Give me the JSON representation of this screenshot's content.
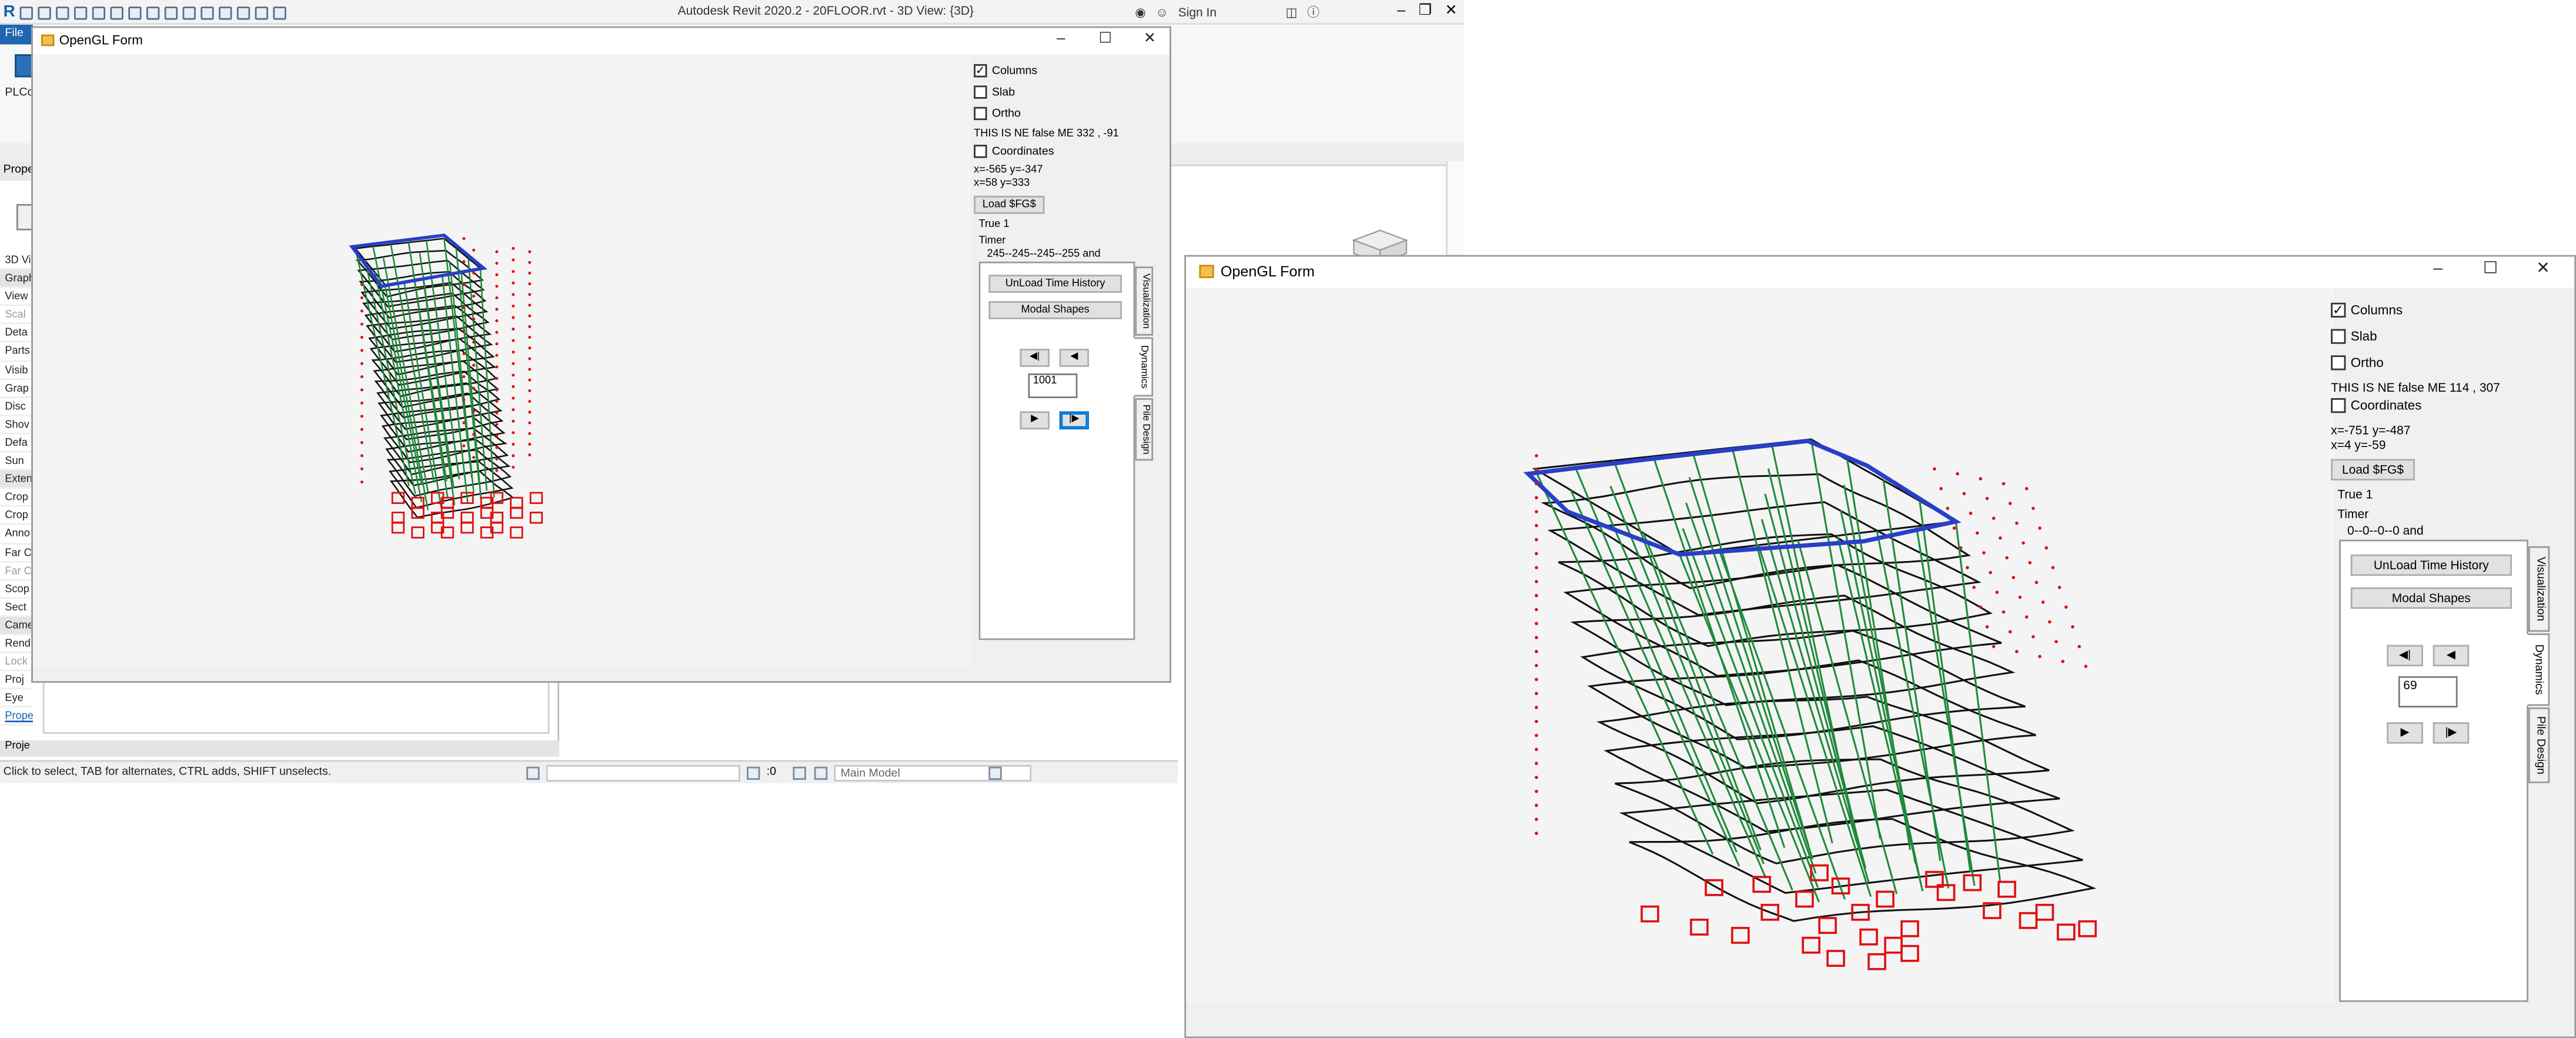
{
  "revit": {
    "title": "Autodesk Revit 2020.2 - 20FLOOR.rvt - 3D View: {3D}",
    "sign_in": "Sign In",
    "file_tab": "File",
    "ribbon_label": "PLCo",
    "properties_header": "Prope",
    "properties_rows": [
      "3D Vi",
      "Graph",
      "View",
      "Scal",
      "Deta",
      "Parts",
      "Visib",
      "Grap",
      "Disc",
      "Shov",
      "Defa",
      "Sun",
      "Exten",
      "Crop",
      "Crop",
      "Anno",
      "Far C",
      "Far C",
      "Scop",
      "Sect",
      "Came",
      "Rend",
      "Lock",
      "Proj",
      "Eye"
    ],
    "properties_link": "Prope",
    "project_browser": "Proje",
    "status_text": "Click to select, TAB for alternates, CTRL adds, SHIFT unselects.",
    "status_zero": ":0",
    "main_model": "Main Model",
    "accent": "#1560a8"
  },
  "gl_small": {
    "title": "OpenGL Form",
    "columns_label": "Columns",
    "slab_label": "Slab",
    "ortho_label": "Ortho",
    "status_line": "THIS IS NE false  ME  332 , -91",
    "coordinates_label": "Coordinates",
    "coords_line1": "x=-565 y=-347",
    "coords_line2": " x=58 y=333",
    "load_button": "Load $FG$",
    "true_label": "True 1",
    "timer_label": "Timer",
    "timer_value": "245--245--245--255 and",
    "unload_button": "UnLoad Time History",
    "modal_button": "Modal Shapes",
    "frame_value": "1001",
    "tab_visualization": "Visualization",
    "tab_dynamics": "Dynamics",
    "tab_pile": "Pile Design",
    "btn_first": "◀|",
    "btn_prev": "◀",
    "btn_play": "▶",
    "btn_last": "|▶"
  },
  "gl_large": {
    "title": "OpenGL Form",
    "columns_label": "Columns",
    "slab_label": "Slab",
    "ortho_label": "Ortho",
    "status_line": "THIS IS NE false  ME  114 , 307",
    "coordinates_label": "Coordinates",
    "coords_line1": "x=-751 y=-487",
    "coords_line2": " x=4 y=-59",
    "load_button": "Load $FG$",
    "true_label": "True 1",
    "timer_label": "Timer",
    "timer_value": "0--0--0--0 and",
    "unload_button": "UnLoad Time History",
    "modal_button": "Modal Shapes",
    "frame_value": "69",
    "tab_visualization": "Visualization",
    "tab_dynamics": "Dynamics",
    "tab_pile": "Pile Design",
    "btn_first": "◀|",
    "btn_prev": "◀",
    "btn_play": "▶",
    "btn_last": "|▶"
  },
  "colors": {
    "slab_outline": "#2840c8",
    "columns": "#1f8a3a",
    "floors": "#111111",
    "piles": "#e01010"
  }
}
